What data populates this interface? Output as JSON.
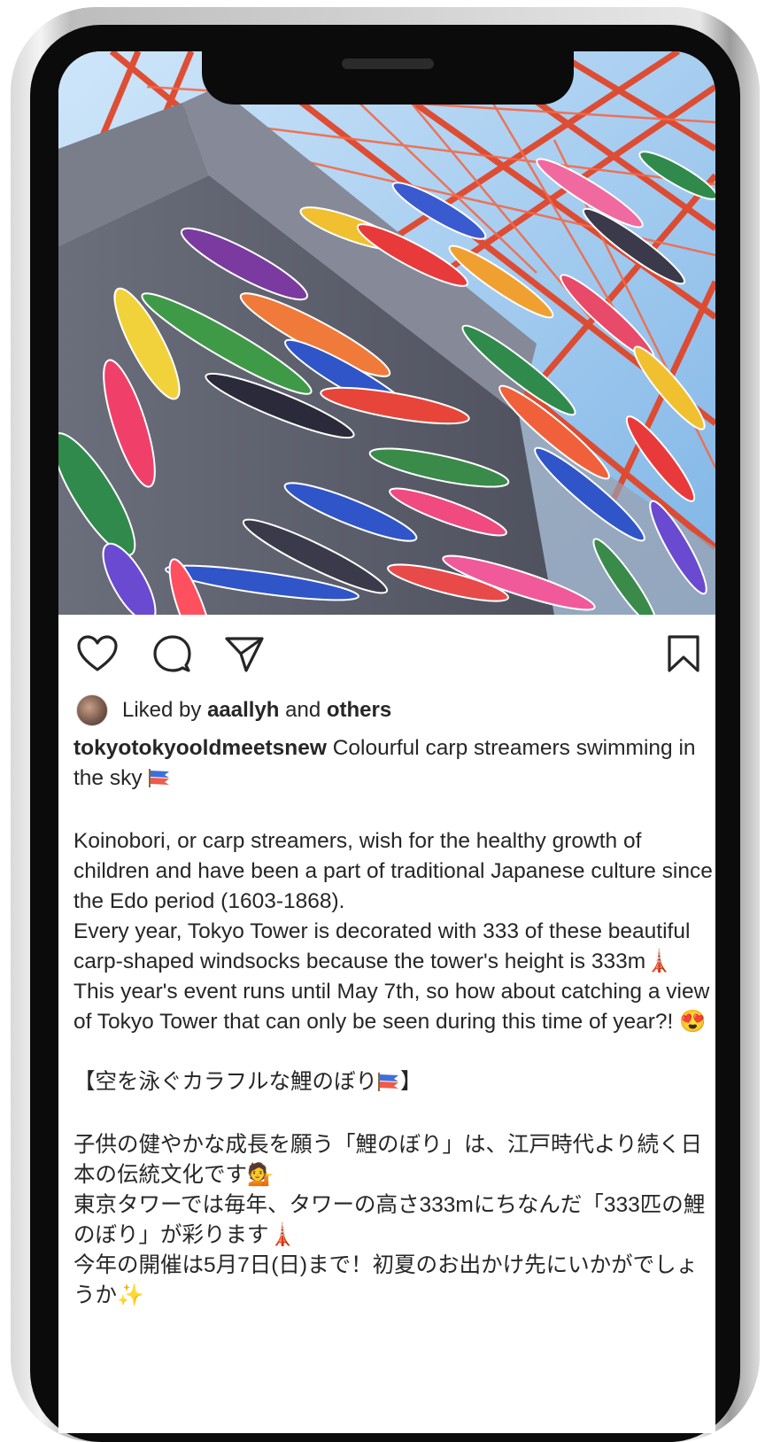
{
  "post": {
    "username": "tokyotokyooldmeetsnew",
    "likes": {
      "prefix": "Liked by ",
      "user": "aaallyh",
      "middle": " and ",
      "others": "others"
    },
    "caption": {
      "headline": " Colourful carp streamers swimming in the sky ",
      "p1": "Koinobori, or carp streamers, wish for the healthy growth of children and have been a part of traditional Japanese culture since the Edo period (1603-1868).",
      "p2": "Every year, Tokyo Tower is decorated with 333 of these beautiful carp-shaped windsocks because the tower's height is 333m🗼",
      "p3": "This year's event runs until May 7th, so how about catching a view of Tokyo Tower that can only be seen during this time of year?! 😍",
      "jp_title_a": "【空を泳ぐカラフルな鯉のぼり",
      "jp_title_b": "】",
      "jp1": "子供の健やかな成長を願う「鯉のぼり」は、江戸時代より続く日本の伝統文化です💁",
      "jp2": "東京タワーでは毎年、タワーの高さ333mにちなんだ「333匹の鯉のぼり」が彩ります🗼",
      "jp3": "今年の開催は5月7日(日)まで！初夏のお出かけ先にいかがでしょうか✨"
    }
  },
  "icons": {
    "like": "heart-icon",
    "comment": "comment-icon",
    "share": "paper-plane-icon",
    "save": "bookmark-icon",
    "flag": "carp-streamer-icon"
  },
  "colors": {
    "tower_red": "#e0462a",
    "sky": "#8fc3ee",
    "building": "#5c5f6c",
    "text": "#262626"
  }
}
